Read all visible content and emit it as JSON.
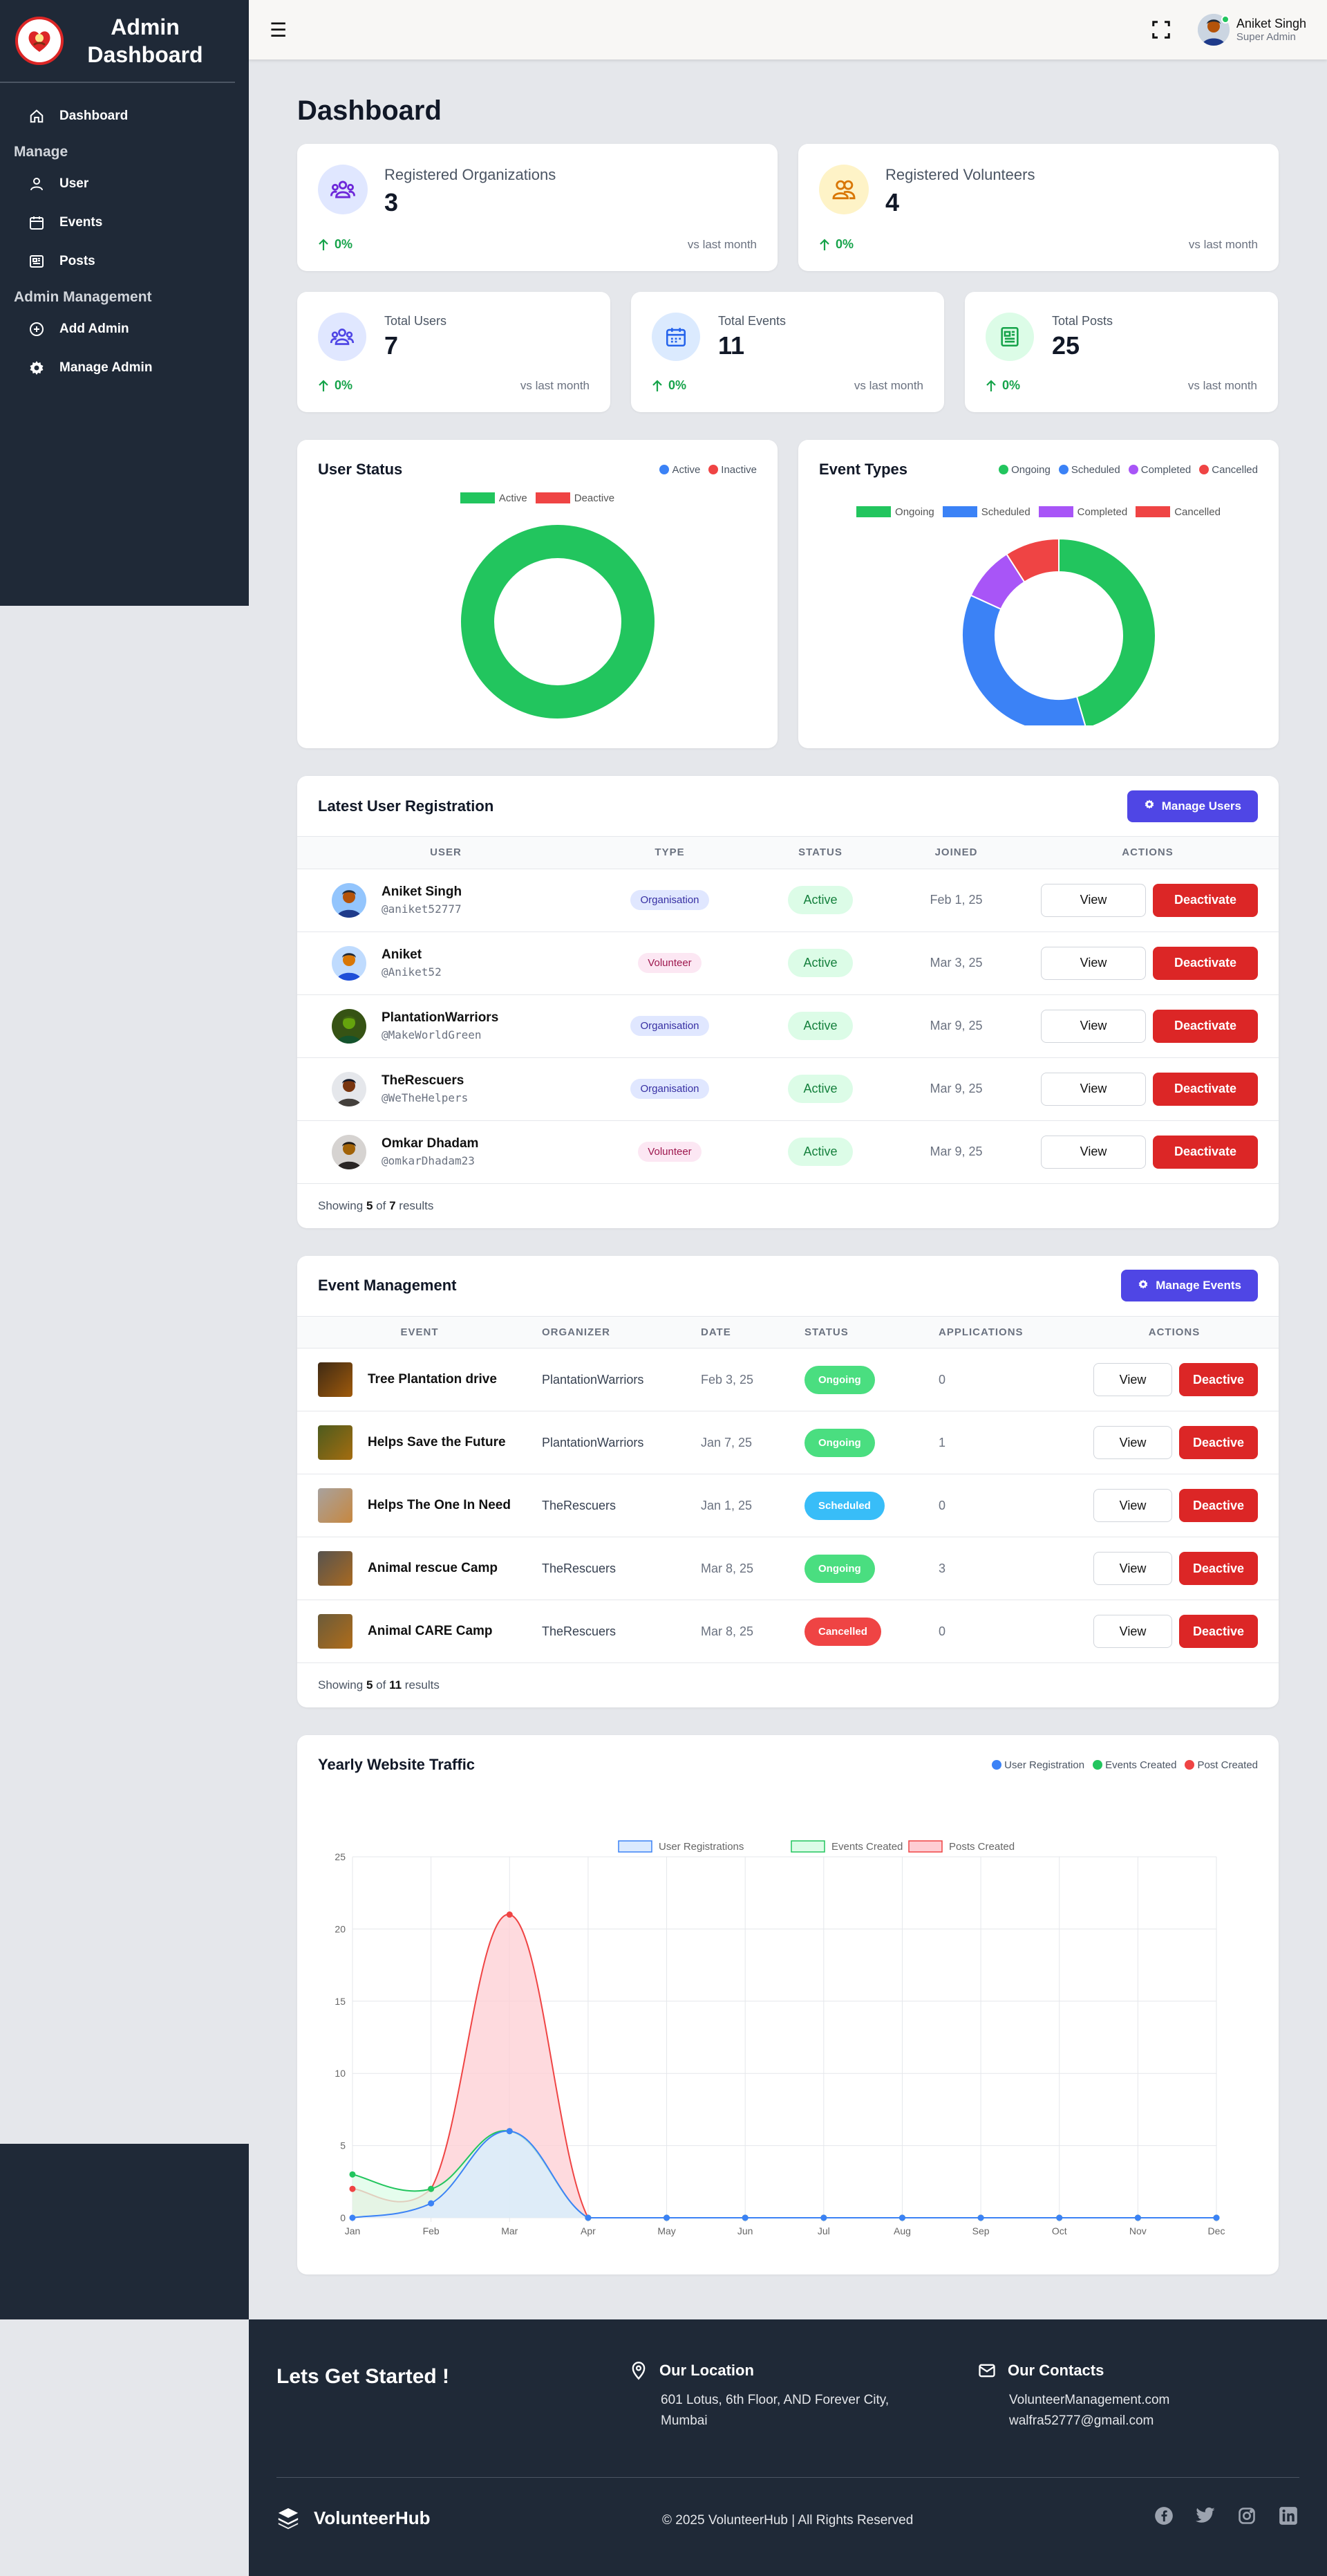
{
  "sidebar": {
    "title": "Admin Dashboard",
    "items": [
      {
        "label": "Dashboard",
        "icon": "home-icon"
      },
      {
        "label": "User",
        "icon": "user-icon"
      },
      {
        "label": "Events",
        "icon": "calendar-icon"
      },
      {
        "label": "Posts",
        "icon": "newspaper-icon"
      },
      {
        "label": "Add Admin",
        "icon": "plus-circle-icon"
      },
      {
        "label": "Manage Admin",
        "icon": "gear-icon"
      }
    ],
    "sections": {
      "manage": "Manage",
      "admin": "Admin Management"
    }
  },
  "topbar": {
    "user_name": "Aniket Singh",
    "user_role": "Super Admin"
  },
  "page_title": "Dashboard",
  "stats_top": [
    {
      "label": "Registered Organizations",
      "value": "3",
      "trend": "0%",
      "vs": "vs last month",
      "color": "#6d28d9",
      "bg": "#e0e7ff",
      "icon": "users-group-icon"
    },
    {
      "label": "Registered Volunteers",
      "value": "4",
      "trend": "0%",
      "vs": "vs last month",
      "color": "#d97706",
      "bg": "#fef3c7",
      "icon": "users-pair-icon"
    }
  ],
  "stats_bottom": [
    {
      "label": "Total Users",
      "value": "7",
      "trend": "0%",
      "vs": "vs last month",
      "color": "#4f46e5",
      "bg": "#e0e7ff",
      "icon": "users-group-icon"
    },
    {
      "label": "Total Events",
      "value": "11",
      "trend": "0%",
      "vs": "vs last month",
      "color": "#2563eb",
      "bg": "#dbeafe",
      "icon": "calendar-icon"
    },
    {
      "label": "Total Posts",
      "value": "25",
      "trend": "0%",
      "vs": "vs last month",
      "color": "#16a34a",
      "bg": "#dcfce7",
      "icon": "newspaper-icon"
    }
  ],
  "user_status": {
    "title": "User Status",
    "legend": [
      {
        "label": "Active",
        "color": "#3b82f6"
      },
      {
        "label": "Inactive",
        "color": "#ef4444"
      }
    ],
    "chart_legend": [
      {
        "label": "Active",
        "color": "#22c55e"
      },
      {
        "label": "Deactive",
        "color": "#ef4444"
      }
    ]
  },
  "event_types": {
    "title": "Event Types",
    "legend": [
      {
        "label": "Ongoing",
        "color": "#22c55e"
      },
      {
        "label": "Scheduled",
        "color": "#3b82f6"
      },
      {
        "label": "Completed",
        "color": "#a855f7"
      },
      {
        "label": "Cancelled",
        "color": "#ef4444"
      }
    ]
  },
  "user_table": {
    "title": "Latest User Registration",
    "manage_label": "Manage Users",
    "columns": [
      "USER",
      "TYPE",
      "STATUS",
      "JOINED",
      "ACTIONS"
    ],
    "rows": [
      {
        "name": "Aniket Singh",
        "handle": "@aniket52777",
        "type": "Organisation",
        "status": "Active",
        "joined": "Feb 1, 25"
      },
      {
        "name": "Aniket",
        "handle": "@Aniket52",
        "type": "Volunteer",
        "status": "Active",
        "joined": "Mar 3, 25"
      },
      {
        "name": "PlantationWarriors",
        "handle": "@MakeWorldGreen",
        "type": "Organisation",
        "status": "Active",
        "joined": "Mar 9, 25"
      },
      {
        "name": "TheRescuers",
        "handle": "@WeTheHelpers",
        "type": "Organisation",
        "status": "Active",
        "joined": "Mar 9, 25"
      },
      {
        "name": "Omkar Dhadam",
        "handle": "@omkarDhadam23",
        "type": "Volunteer",
        "status": "Active",
        "joined": "Mar 9, 25"
      }
    ],
    "view_label": "View",
    "action_label": "Deactivate",
    "foot": {
      "prefix": "Showing",
      "shown": "5",
      "of": "of",
      "total": "7",
      "suffix": "results"
    }
  },
  "event_table": {
    "title": "Event Management",
    "manage_label": "Manage Events",
    "columns": [
      "EVENT",
      "ORGANIZER",
      "DATE",
      "STATUS",
      "APPLICATIONS",
      "ACTIONS"
    ],
    "rows": [
      {
        "name": "Tree Plantation drive",
        "organizer": "PlantationWarriors",
        "date": "Feb 3, 25",
        "status": "Ongoing",
        "status_color": "#4ade80",
        "applications": "0"
      },
      {
        "name": "Helps Save the Future",
        "organizer": "PlantationWarriors",
        "date": "Jan 7, 25",
        "status": "Ongoing",
        "status_color": "#4ade80",
        "applications": "1"
      },
      {
        "name": "Helps The One In Need",
        "organizer": "TheRescuers",
        "date": "Jan 1, 25",
        "status": "Scheduled",
        "status_color": "#38bdf8",
        "applications": "0"
      },
      {
        "name": "Animal rescue Camp",
        "organizer": "TheRescuers",
        "date": "Mar 8, 25",
        "status": "Ongoing",
        "status_color": "#4ade80",
        "applications": "3"
      },
      {
        "name": "Animal CARE Camp",
        "organizer": "TheRescuers",
        "date": "Mar 8, 25",
        "status": "Cancelled",
        "status_color": "#ef4444",
        "applications": "0"
      }
    ],
    "view_label": "View",
    "action_label": "Deactive",
    "foot": {
      "prefix": "Showing",
      "shown": "5",
      "of": "of",
      "total": "11",
      "suffix": "results"
    }
  },
  "traffic": {
    "title": "Yearly Website Traffic",
    "legend_dots": [
      {
        "label": "User Registration",
        "color": "#3b82f6"
      },
      {
        "label": "Events Created",
        "color": "#22c55e"
      },
      {
        "label": "Post Created",
        "color": "#ef4444"
      }
    ]
  },
  "chart_data": [
    {
      "type": "pie",
      "title": "User Status",
      "categories": [
        "Active",
        "Deactive"
      ],
      "values": [
        7,
        0
      ],
      "colors": [
        "#22c55e",
        "#ef4444"
      ],
      "donut": true
    },
    {
      "type": "pie",
      "title": "Event Types",
      "categories": [
        "Ongoing",
        "Scheduled",
        "Completed",
        "Cancelled"
      ],
      "values": [
        5,
        4,
        1,
        1
      ],
      "colors": [
        "#22c55e",
        "#3b82f6",
        "#a855f7",
        "#ef4444"
      ],
      "donut": true
    },
    {
      "type": "area",
      "title": "Yearly Website Traffic",
      "categories": [
        "Jan",
        "Feb",
        "Mar",
        "Apr",
        "May",
        "Jun",
        "Jul",
        "Aug",
        "Sep",
        "Oct",
        "Nov",
        "Dec"
      ],
      "series": [
        {
          "name": "User Registrations",
          "values": [
            0,
            1,
            6,
            0,
            0,
            0,
            0,
            0,
            0,
            0,
            0,
            0
          ],
          "color": "#3b82f6",
          "fill": "#dbeafe"
        },
        {
          "name": "Events Created",
          "values": [
            3,
            2,
            6,
            0,
            0,
            0,
            0,
            0,
            0,
            0,
            0,
            0
          ],
          "color": "#22c55e",
          "fill": "#dcfce7"
        },
        {
          "name": "Posts Created",
          "values": [
            2,
            2,
            21,
            0,
            0,
            0,
            0,
            0,
            0,
            0,
            0,
            0
          ],
          "color": "#ef4444",
          "fill": "#fecdd3"
        }
      ],
      "ylim": [
        0,
        25
      ],
      "yticks": [
        0,
        5,
        10,
        15,
        20,
        25
      ],
      "grid": true,
      "legend": "top"
    }
  ],
  "footer": {
    "cta": "Lets Get Started !",
    "location_title": "Our Location",
    "location_text": "601 Lotus, 6th Floor, AND Forever City, Mumbai",
    "contacts_title": "Our Contacts",
    "contact_site": "VolunteerManagement.com",
    "contact_email": "walfra52777@gmail.com",
    "brand": "VolunteerHub",
    "copyright": "© 2025 VolunteerHub | All Rights Reserved",
    "social": [
      "facebook-icon",
      "twitter-icon",
      "instagram-icon",
      "linkedin-icon"
    ]
  }
}
